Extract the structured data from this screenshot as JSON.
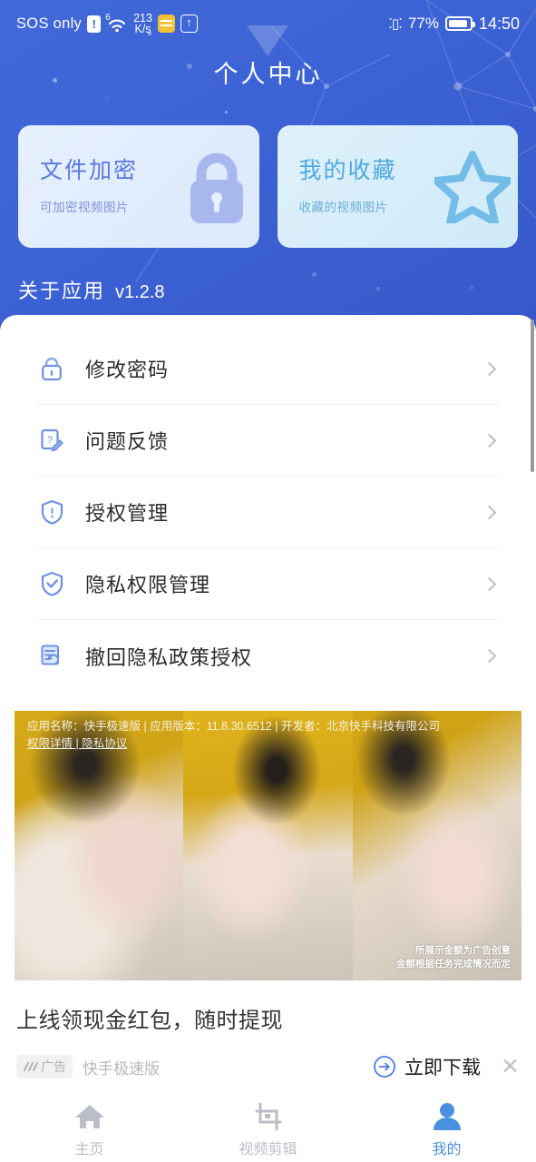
{
  "theme": {
    "hero_blue": "#3c63d6",
    "accent_blue": "#4a90e2",
    "enc_card_title": "#5b79e0",
    "fav_card_title": "#4fa8e0",
    "inactive_tab": "#b9bec7"
  },
  "statusbar": {
    "carrier": "SOS only",
    "alert_icon": "!",
    "wifi_sup": "6",
    "wifi_icon": "wifi-icon",
    "netspeed_value": "213",
    "netspeed_unit": "K/s",
    "sim_icon": "sim-card-icon",
    "upload_icon": "upload-arrow-icon",
    "vibrate_icon": "vibrate-icon",
    "battery_percent": "77%",
    "battery_icon": "battery-icon",
    "time": "14:50"
  },
  "header": {
    "title": "个人中心"
  },
  "cards": [
    {
      "title": "文件加密",
      "subtitle": "可加密视频图片",
      "icon": "lock-icon"
    },
    {
      "title": "我的收藏",
      "subtitle": "收藏的视频图片",
      "icon": "star-icon"
    }
  ],
  "about": {
    "label": "关于应用",
    "version": "v1.2.8"
  },
  "menu": [
    {
      "label": "修改密码",
      "icon": "lock-icon",
      "chevron": "chevron-right-icon"
    },
    {
      "label": "问题反馈",
      "icon": "feedback-pencil-icon",
      "chevron": "chevron-right-icon"
    },
    {
      "label": "授权管理",
      "icon": "shield-icon",
      "chevron": "chevron-right-icon"
    },
    {
      "label": "隐私权限管理",
      "icon": "shield-check-icon",
      "chevron": "chevron-right-icon"
    },
    {
      "label": "撤回隐私政策授权",
      "icon": "document-revoke-icon",
      "chevron": "chevron-right-icon"
    }
  ],
  "ad": {
    "legal_line1": "应用名称：快手极速版 | 应用版本：11.8.30.6512 | 开发者：北京快手科技有限公司",
    "legal_line2": "权限详情 | 隐私协议",
    "disclaimer_line1": "所展示金额为广告创意",
    "disclaimer_line2": "金额根据任务完成情况而定",
    "title": "上线领现金红包，随时提现",
    "chip_label": "广告",
    "chip_icon": "ad-waveform-icon",
    "brand": "快手极速版",
    "cta_label": "立即下载",
    "cta_icon": "download-arrow-icon",
    "close_icon": "close-icon"
  },
  "tabbar": [
    {
      "label": "主页",
      "icon": "home-icon",
      "active": false
    },
    {
      "label": "视频剪辑",
      "icon": "crop-icon",
      "active": false
    },
    {
      "label": "我的",
      "icon": "person-icon",
      "active": true
    }
  ]
}
